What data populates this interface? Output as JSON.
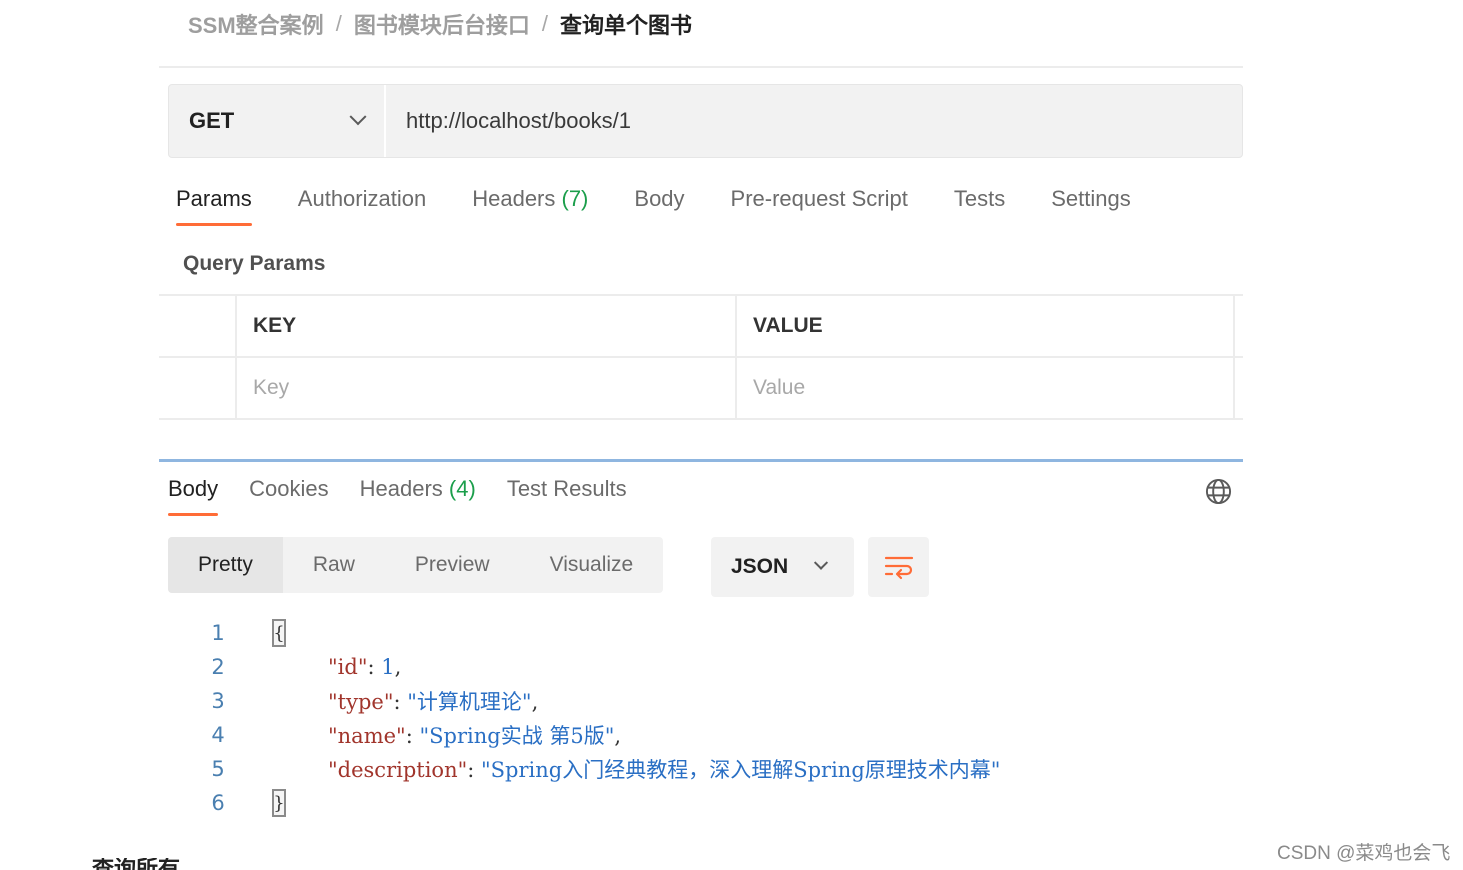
{
  "breadcrumb": {
    "items": [
      "SSM整合案例",
      "图书模块后台接口"
    ],
    "current": "查询单个图书",
    "separator": "/"
  },
  "request": {
    "method": "GET",
    "url": "http://localhost/books/1"
  },
  "request_tabs": {
    "params": "Params",
    "authorization": "Authorization",
    "headers": "Headers",
    "headers_count": "(7)",
    "body": "Body",
    "prerequest": "Pre-request Script",
    "tests": "Tests",
    "settings": "Settings"
  },
  "query_params": {
    "title": "Query Params",
    "columns": [
      "KEY",
      "VALUE"
    ],
    "placeholders": [
      "Key",
      "Value"
    ]
  },
  "response_tabs": {
    "body": "Body",
    "cookies": "Cookies",
    "headers": "Headers",
    "headers_count": "(4)",
    "test_results": "Test Results"
  },
  "view_modes": {
    "pretty": "Pretty",
    "raw": "Raw",
    "preview": "Preview",
    "visualize": "Visualize"
  },
  "format": "JSON",
  "code": {
    "line_numbers": [
      "1",
      "2",
      "3",
      "4",
      "5",
      "6"
    ],
    "open_brace": "{",
    "close_brace": "}",
    "fields": [
      {
        "key": "\"id\"",
        "value": "1",
        "comma": ","
      },
      {
        "key": "\"type\"",
        "value": "\"计算机理论\"",
        "comma": ","
      },
      {
        "key": "\"name\"",
        "value": "\"Spring实战 第5版\"",
        "comma": ","
      },
      {
        "key": "\"description\"",
        "value": "\"Spring入门经典教程，深入理解Spring原理技术内幕\"",
        "comma": ""
      }
    ]
  },
  "watermark": "CSDN @菜鸡也会飞",
  "bottom_cut_text": "查询所有",
  "colors": {
    "accent": "#ff6c37",
    "count_green": "#1b9e4b",
    "json_key": "#a1352c",
    "json_value": "#2a6fc4"
  }
}
